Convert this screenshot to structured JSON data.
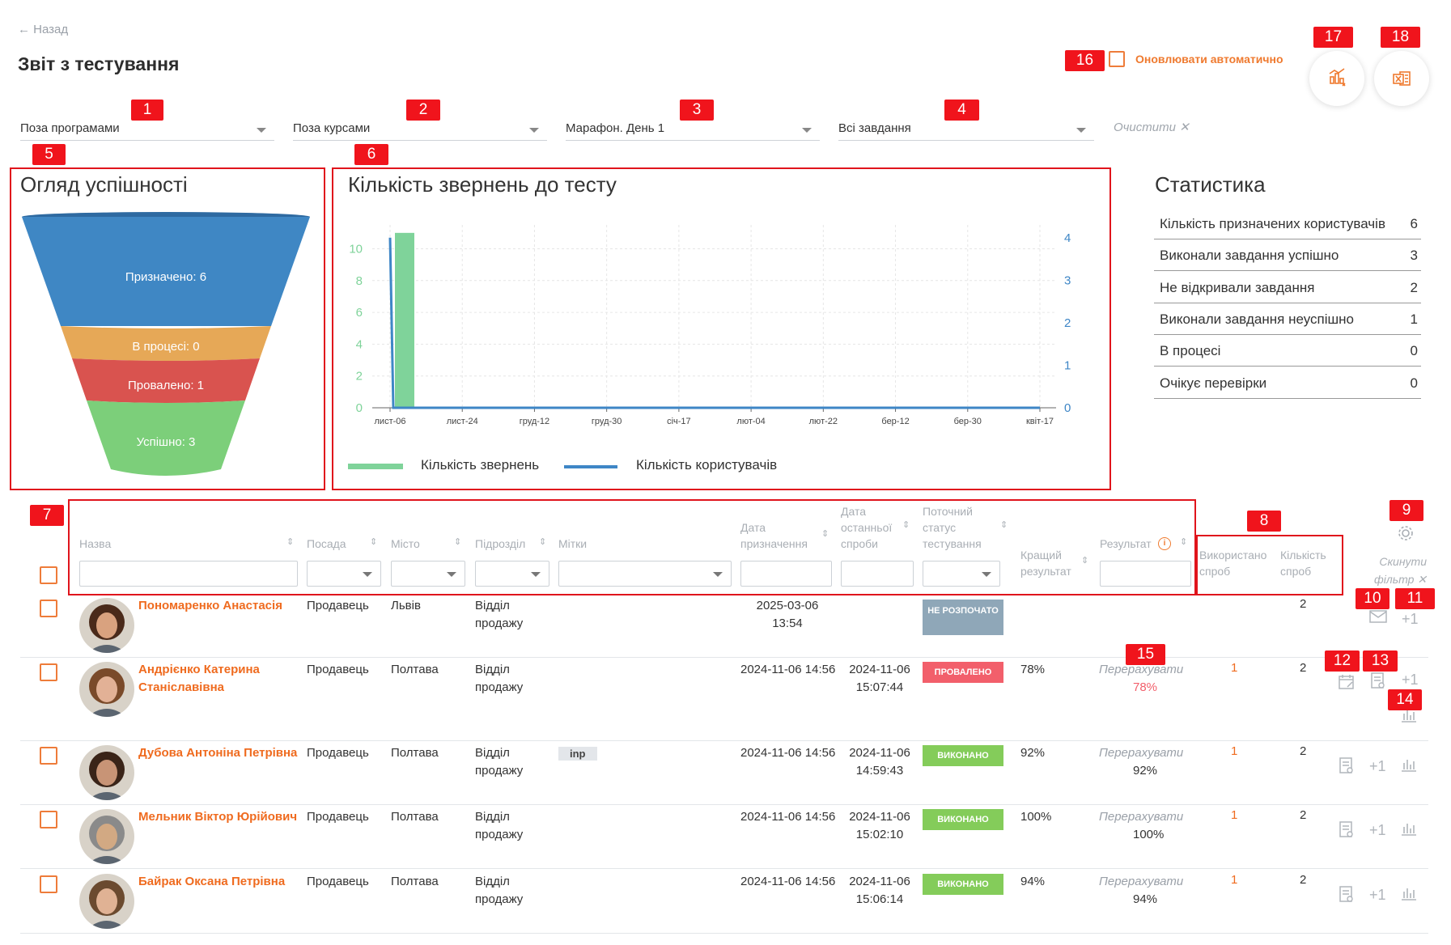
{
  "header": {
    "back_label": "← Назад",
    "page_title": "Звіт з тестування",
    "auto_refresh_label": "Оновлювати автоматично"
  },
  "filters": {
    "program": "Поза програмами",
    "course": "Поза курсами",
    "marathon": "Марафон. День 1",
    "tasks": "Всі завдання",
    "clear_label": "Очистити ✕"
  },
  "badges": [
    "1",
    "2",
    "3",
    "4",
    "5",
    "6",
    "7",
    "8",
    "9",
    "10",
    "11",
    "12",
    "13",
    "14",
    "15",
    "16",
    "17",
    "18"
  ],
  "funnel": {
    "title": "Огляд успішності",
    "segments": [
      {
        "label": "Призначено: 6",
        "color": "#3f87c4"
      },
      {
        "label": "В процесі: 0",
        "color": "#e6a857"
      },
      {
        "label": "Провалено: 1",
        "color": "#d9534f"
      },
      {
        "label": "Успішно: 3",
        "color": "#7ccf7a"
      }
    ]
  },
  "chart_data": {
    "type": "bar",
    "title": "Кількість звернень до тесту",
    "x_ticks": [
      "лист-06",
      "лист-24",
      "груд-12",
      "груд-30",
      "січ-17",
      "лют-04",
      "лют-22",
      "бер-12",
      "бер-30",
      "квіт-17"
    ],
    "y_left_ticks": [
      "0",
      "2",
      "4",
      "6",
      "8",
      "10"
    ],
    "y_right_ticks": [
      "0",
      "1",
      "2",
      "3",
      "4"
    ],
    "ylim_left": [
      0,
      11.5
    ],
    "ylim_right": [
      0,
      4.3
    ],
    "series": [
      {
        "name": "Кількість звернень",
        "type": "bar",
        "axis": "left",
        "color": "#7fd39a",
        "points": [
          {
            "x": "лист-06",
            "y": 11
          }
        ]
      },
      {
        "name": "Кількість користувачів",
        "type": "line",
        "axis": "right",
        "color": "#3e86c6",
        "points": [
          {
            "x": "лист-06",
            "y": 4
          },
          {
            "x": "лист-06+",
            "y": 0
          },
          {
            "x": "квіт-17",
            "y": 0
          }
        ]
      }
    ],
    "legend_position": "bottom",
    "grid": true
  },
  "stats": {
    "title": "Статистика",
    "rows": [
      {
        "label": "Кількість призначених користувачів",
        "value": "6"
      },
      {
        "label": "Виконали завдання успішно",
        "value": "3"
      },
      {
        "label": "Не відкривали завдання",
        "value": "2"
      },
      {
        "label": "Виконали завдання неуспішно",
        "value": "1"
      },
      {
        "label": "В процесі",
        "value": "0"
      },
      {
        "label": "Очікує перевірки",
        "value": "0"
      }
    ]
  },
  "table": {
    "headers": {
      "name": "Назва",
      "position": "Посада",
      "city": "Місто",
      "department": "Підрозділ",
      "tags": "Мітки",
      "assign_date": "Дата призначення",
      "last_attempt": "Дата останньої спроби",
      "status": "Поточний статус тестування",
      "best": "Кращий результат",
      "result": "Результат",
      "used_attempts": "Використано спроб",
      "attempt_count": "Кількість спроб"
    },
    "reset_filter_label": "Скинути фільтр ✕",
    "rows": [
      {
        "name": "Пономаренко Анастасія",
        "position": "Продавець",
        "city": "Львів",
        "department": "Відділ продажу",
        "tag": "",
        "assign_date": "2025-03-06 13:54",
        "last_attempt": "",
        "status": "НЕ РОЗПОЧАТО",
        "status_color": "#8fa7b8",
        "best": "",
        "recalc": "",
        "recalc_pct": "",
        "used": "",
        "count": "2"
      },
      {
        "name": "Андрієнко Катерина Станіславівна",
        "position": "Продавець",
        "city": "Полтава",
        "department": "Відділ продажу",
        "tag": "",
        "assign_date": "2024-11-06 14:56",
        "last_attempt": "2024-11-06 15:07:44",
        "status": "ПРОВАЛЕНО",
        "status_color": "#f25f6b",
        "best": "78%",
        "recalc": "Перерахувати",
        "recalc_pct": "78%",
        "used": "1",
        "count": "2"
      },
      {
        "name": "Дубова Антоніна Петрівна",
        "position": "Продавець",
        "city": "Полтава",
        "department": "Відділ продажу",
        "tag": "inp",
        "assign_date": "2024-11-06 14:56",
        "last_attempt": "2024-11-06 14:59:43",
        "status": "ВИКОНАНО",
        "status_color": "#84cc5a",
        "best": "92%",
        "recalc": "Перерахувати",
        "recalc_pct": "92%",
        "used": "1",
        "count": "2"
      },
      {
        "name": "Мельник Віктор Юрійович",
        "position": "Продавець",
        "city": "Полтава",
        "department": "Відділ продажу",
        "tag": "",
        "assign_date": "2024-11-06 14:56",
        "last_attempt": "2024-11-06 15:02:10",
        "status": "ВИКОНАНО",
        "status_color": "#84cc5a",
        "best": "100%",
        "recalc": "Перерахувати",
        "recalc_pct": "100%",
        "used": "1",
        "count": "2"
      },
      {
        "name": "Байрак Оксана Петрівна",
        "position": "Продавець",
        "city": "Полтава",
        "department": "Відділ продажу",
        "tag": "",
        "assign_date": "2024-11-06 14:56",
        "last_attempt": "2024-11-06 15:06:14",
        "status": "ВИКОНАНО",
        "status_color": "#84cc5a",
        "best": "94%",
        "recalc": "Перерахувати",
        "recalc_pct": "94%",
        "used": "1",
        "count": "2"
      }
    ]
  }
}
